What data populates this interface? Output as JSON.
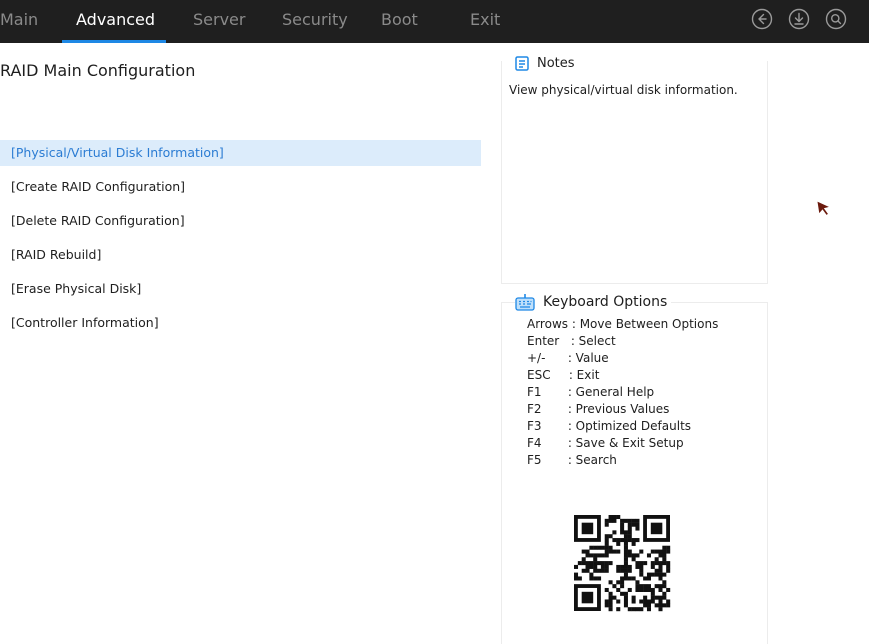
{
  "nav": {
    "tabs": [
      {
        "label": "Main"
      },
      {
        "label": "Advanced"
      },
      {
        "label": "Server"
      },
      {
        "label": "Security"
      },
      {
        "label": "Boot"
      },
      {
        "label": "Exit"
      }
    ],
    "active_tab": "Advanced",
    "icons": [
      "back-icon",
      "download-icon",
      "search-icon"
    ]
  },
  "page": {
    "title": "RAID Main Configuration"
  },
  "menu": {
    "items": [
      {
        "label": "[Physical/Virtual Disk Information]"
      },
      {
        "label": "[Create RAID Configuration]"
      },
      {
        "label": "[Delete RAID Configuration]"
      },
      {
        "label": "[RAID Rebuild]"
      },
      {
        "label": "[Erase Physical Disk]"
      },
      {
        "label": "[Controller Information]"
      }
    ],
    "selected_index": 0
  },
  "notes": {
    "title": "Notes",
    "text": "View physical/virtual disk information."
  },
  "keyboard": {
    "title": "Keyboard Options",
    "rows": [
      {
        "key": "Arrows",
        "desc": ": Move Between Options"
      },
      {
        "key": "Enter",
        "desc": ": Select"
      },
      {
        "key": "+/-",
        "desc": ": Value"
      },
      {
        "key": "ESC",
        "desc": ": Exit"
      },
      {
        "key": "F1",
        "desc": ": General Help"
      },
      {
        "key": "F2",
        "desc": ": Previous Values"
      },
      {
        "key": "F3",
        "desc": ": Optimized Defaults"
      },
      {
        "key": "F4",
        "desc": ": Save & Exit Setup"
      },
      {
        "key": "F5",
        "desc": ": Search"
      }
    ]
  },
  "colors": {
    "topbar": "#1f1f1f",
    "accent": "#1e88e5",
    "selected_bg": "#dcecfb",
    "selected_text": "#2b7cd3"
  }
}
